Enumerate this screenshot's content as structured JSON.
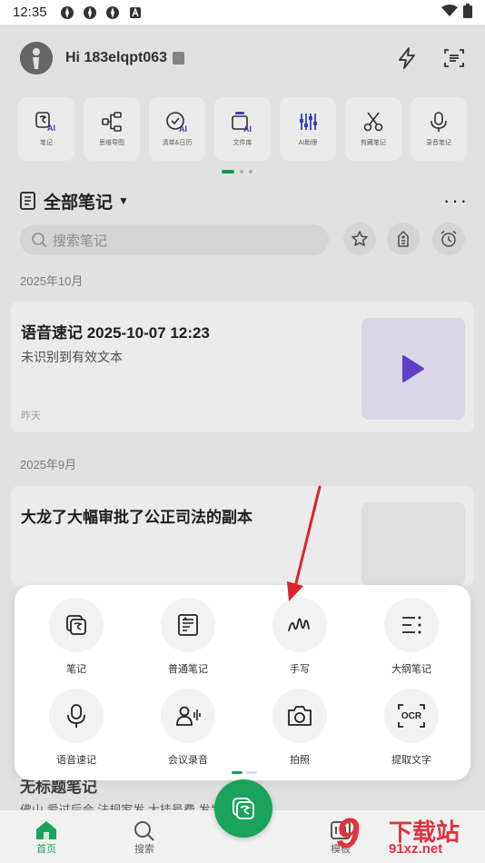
{
  "status_bar": {
    "time": "12:35"
  },
  "header": {
    "greeting": "Hi 183elqpt063"
  },
  "tools": [
    {
      "label": "笔记",
      "icon": "ai-note-icon"
    },
    {
      "label": "思维导图",
      "icon": "mindmap-icon"
    },
    {
      "label": "清单&日历",
      "icon": "ai-checklist-icon"
    },
    {
      "label": "文件库",
      "icon": "ai-file-library-icon"
    },
    {
      "label": "AI助理",
      "icon": "ai-assistant-icon"
    },
    {
      "label": "剪藏笔记",
      "icon": "clip-icon"
    },
    {
      "label": "录音笔记",
      "icon": "microphone-icon"
    }
  ],
  "notes_section": {
    "title": "全部笔记",
    "search_placeholder": "搜索笔记"
  },
  "groups": [
    {
      "label": "2025年10月",
      "note": {
        "title": "语音速记 2025-10-07 12:23",
        "subtitle": "未识别到有效文本",
        "date": "昨天"
      }
    },
    {
      "label": "2025年9月",
      "note": {
        "title": "大龙了大幅审批了公正司法的副本"
      }
    }
  ],
  "behind": {
    "title": "无标题笔记",
    "preview": "佛山 爱过后会 法规家发 大挂号费 发发顺丰是"
  },
  "popup": {
    "items": [
      {
        "label": "笔记",
        "icon": "note-icon"
      },
      {
        "label": "普通笔记",
        "icon": "plain-note-icon"
      },
      {
        "label": "手写",
        "icon": "handwriting-icon"
      },
      {
        "label": "大纲笔记",
        "icon": "outline-icon"
      },
      {
        "label": "语音速记",
        "icon": "microphone-icon"
      },
      {
        "label": "会议录音",
        "icon": "meeting-icon"
      },
      {
        "label": "拍照",
        "icon": "camera-icon"
      },
      {
        "label": "提取文字",
        "icon": "ocr-icon"
      }
    ],
    "ocr_text": "OCR"
  },
  "bottom_nav": {
    "home": "首页",
    "search": "搜索",
    "template": "模板"
  },
  "watermark": {
    "glyph": "9",
    "text": "下载站",
    "url": "91xz.net"
  },
  "colors": {
    "accent": "#1aa35a",
    "play": "#6a44d8",
    "annotation": "#d9242a"
  }
}
